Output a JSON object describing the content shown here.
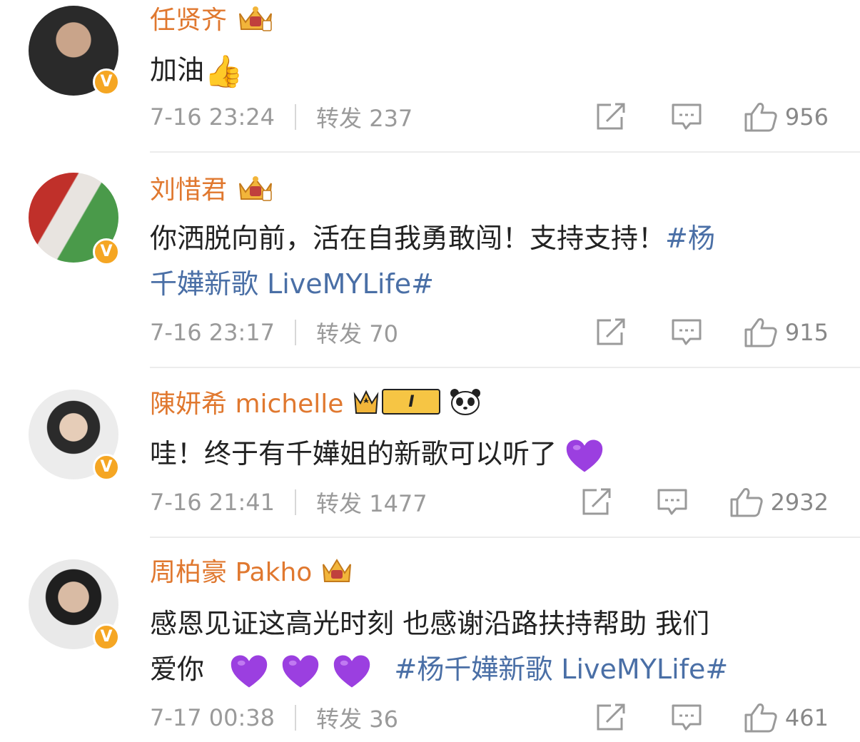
{
  "comments": [
    {
      "name": "任贤齐",
      "text": "加油",
      "emoji": "thumbs-up",
      "time": "7-16 23:24",
      "forward_label": "转发",
      "forward_count": "237",
      "likes": "956"
    },
    {
      "name": "刘惜君",
      "text": "你洒脱向前，活在自我勇敢闯！支持支持！",
      "hashtag_part1": "#杨",
      "hashtag_part2": "千嬅新歌 LiveMYLife#",
      "time": "7-16 23:17",
      "forward_label": "转发",
      "forward_count": "70",
      "likes": "915"
    },
    {
      "name": "陳妍希 michelle",
      "level": "I",
      "text": "哇！终于有千嬅姐的新歌可以听了",
      "time": "7-16 21:41",
      "forward_label": "转发",
      "forward_count": "1477",
      "likes": "2932"
    },
    {
      "name": "周柏豪 Pakho",
      "text_line1": "感恩见证这高光时刻 也感谢沿路扶持帮助 我们",
      "text_line2": "爱你",
      "hashtag": "#杨千嬅新歌 LiveMYLife#",
      "time": "7-17 00:38",
      "forward_label": "转发",
      "forward_count": "36",
      "likes": "461"
    }
  ],
  "icons": {
    "verified": "V",
    "share": "share-icon",
    "comment": "comment-icon",
    "like": "like-icon"
  },
  "colors": {
    "name": "#e0782f",
    "hashtag": "#4a6fa6",
    "meta": "#9a9a9a",
    "verified": "#f5a623",
    "heart": "#9b3fe0"
  }
}
